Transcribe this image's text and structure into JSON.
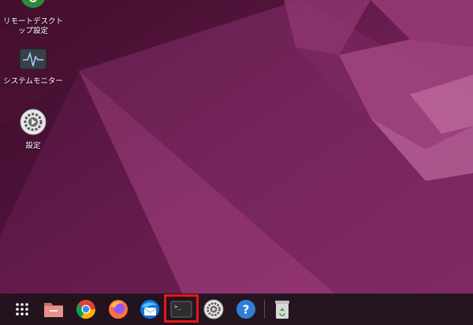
{
  "colors": {
    "wallpaper_dark": "#3e0d2b",
    "wallpaper_mid": "#7a2560",
    "wallpaper_light": "#b0468a",
    "dock_bg": "#1c121a",
    "highlight": "#e11919"
  },
  "desktop": {
    "icons": [
      {
        "label": "リモートデスクトップ設定",
        "icon": "remote-desktop-icon"
      },
      {
        "label": "システムモニター",
        "icon": "system-monitor-icon"
      },
      {
        "label": "設定",
        "icon": "settings-gear-icon"
      }
    ]
  },
  "dock": {
    "items": [
      {
        "name": "show-apps",
        "icon": "app-grid-icon"
      },
      {
        "name": "files",
        "icon": "folder-icon"
      },
      {
        "name": "chrome",
        "icon": "chrome-icon"
      },
      {
        "name": "firefox",
        "icon": "firefox-icon"
      },
      {
        "name": "thunderbird",
        "icon": "thunderbird-icon"
      },
      {
        "name": "terminal",
        "icon": "terminal-icon",
        "highlighted": true
      },
      {
        "name": "settings",
        "icon": "settings-gear-icon"
      },
      {
        "name": "help",
        "icon": "help-icon",
        "label": "?"
      },
      {
        "name": "trash",
        "icon": "trash-icon"
      }
    ],
    "terminal_prompt": ">_"
  }
}
